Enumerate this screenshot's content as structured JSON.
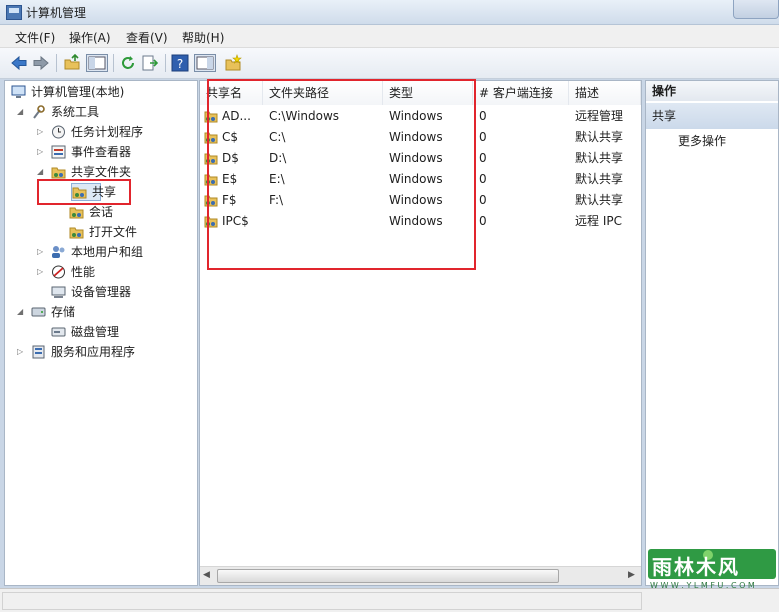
{
  "window": {
    "title": "计算机管理"
  },
  "menu": [
    "文件(F)",
    "操作(A)",
    "查看(V)",
    "帮助(H)"
  ],
  "tree": {
    "root": "计算机管理(本地)",
    "system_tools": "系统工具",
    "task_scheduler": "任务计划程序",
    "event_viewer": "事件查看器",
    "shared_folders": "共享文件夹",
    "shares": "共享",
    "sessions": "会话",
    "open_files": "打开文件",
    "local_users": "本地用户和组",
    "performance": "性能",
    "device_manager": "设备管理器",
    "storage": "存储",
    "disk_mgmt": "磁盘管理",
    "services_apps": "服务和应用程序"
  },
  "list": {
    "headers": [
      "共享名",
      "文件夹路径",
      "类型",
      "# 客户端连接",
      "描述"
    ],
    "rows": [
      {
        "name": "AD...",
        "path": "C:\\Windows",
        "type": "Windows",
        "clients": "0",
        "desc": "远程管理"
      },
      {
        "name": "C$",
        "path": "C:\\",
        "type": "Windows",
        "clients": "0",
        "desc": "默认共享"
      },
      {
        "name": "D$",
        "path": "D:\\",
        "type": "Windows",
        "clients": "0",
        "desc": "默认共享"
      },
      {
        "name": "E$",
        "path": "E:\\",
        "type": "Windows",
        "clients": "0",
        "desc": "默认共享"
      },
      {
        "name": "F$",
        "path": "F:\\",
        "type": "Windows",
        "clients": "0",
        "desc": "默认共享"
      },
      {
        "name": "IPC$",
        "path": "",
        "type": "Windows",
        "clients": "0",
        "desc": "远程 IPC"
      }
    ]
  },
  "actions": {
    "header": "操作",
    "section": "共享",
    "more": "更多操作"
  },
  "watermark": {
    "brand": "雨林木风",
    "url": "W W W . Y L M F U . C O M"
  },
  "colors": {
    "highlight_box": "#e1252d",
    "accent": "#3c6db0"
  }
}
